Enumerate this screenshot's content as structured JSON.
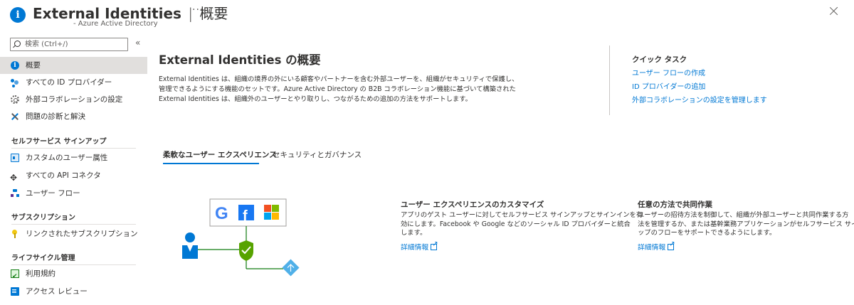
{
  "header": {
    "title": "External Identities",
    "separator": "|",
    "page": "概要",
    "more": "···",
    "subtitle": "- Azure Active Directory",
    "icon": "info-icon",
    "close_icon": "close-icon"
  },
  "sidebar": {
    "search_placeholder": "検索 (Ctrl+/)",
    "collapse": "«",
    "items": [
      {
        "label": "概要",
        "icon": "info-icon"
      },
      {
        "label": "すべての ID プロバイダー",
        "icon": "users-icon"
      },
      {
        "label": "外部コラボレーションの設定",
        "icon": "gear-icon"
      },
      {
        "label": "問題の診断と解決",
        "icon": "wrench-icon"
      }
    ],
    "sections": [
      {
        "title": "セルフサービス サインアップ",
        "items": [
          {
            "label": "カスタムのユーザー属性",
            "icon": "card-icon"
          },
          {
            "label": "すべての API コネクタ",
            "icon": "api-connector-icon"
          },
          {
            "label": "ユーザー フロー",
            "icon": "user-flow-icon"
          }
        ]
      },
      {
        "title": "サブスクリプション",
        "items": [
          {
            "label": "リンクされたサブスクリプション",
            "icon": "key-icon"
          }
        ]
      },
      {
        "title": "ライフサイクル管理",
        "items": [
          {
            "label": "利用規約",
            "icon": "terms-icon"
          },
          {
            "label": "アクセス レビュー",
            "icon": "access-review-icon"
          }
        ]
      }
    ]
  },
  "main": {
    "title": "External Identities の概要",
    "description_lines": [
      "External Identities は、組織の境界の外にいる顧客やパートナーを含む外部ユーザーを、組織がセキュリティで保護し、",
      "管理できるようにする機能のセットです。Azure Active Directory の B2B コラボレーション機能に基づいて構築された",
      "External Identities は、組織外のユーザーとやり取りし、つながるための追加の方法をサポートします。"
    ],
    "quick_tasks": {
      "title": "クイック タスク",
      "links": [
        "ユーザー フローの作成",
        "ID プロバイダーの追加",
        "外部コラボレーションの設定を管理します"
      ]
    },
    "tabs": [
      "柔軟なユーザー エクスペリエンス",
      "セキュリティとガバナンス"
    ],
    "active_tab": 0,
    "cards": [
      {
        "title": "ユーザー エクスペリエンスのカスタマイズ",
        "body_lines": [
          "アプリのゲスト ユーザーに対してセルフサービス サインアップとサインインを有",
          "効にします。Facebook や Google などのソーシャル ID プロバイダーと統合",
          "します。"
        ],
        "link": "詳細情報"
      },
      {
        "title": "任意の方法で共同作業",
        "body_lines": [
          "ユーザーの招待方法を制御して、組織が外部ユーザーと共同作業する方",
          "法を管理するか、または基幹業務アプリケーションがセルフサービス サインア",
          "ップのフローをサポートできるようにします。"
        ],
        "link": "詳細情報"
      }
    ],
    "illustration": {
      "providers": [
        "google-logo-icon",
        "facebook-logo-icon",
        "microsoft-logo-icon"
      ],
      "google_letter": "G",
      "facebook_letter": "f",
      "colors": {
        "google": "#4285f4",
        "facebook": "#1877f2",
        "ms_red": "#f25022",
        "ms_green": "#7fba00",
        "ms_blue": "#00a4ef",
        "ms_yellow": "#ffb900",
        "shield": "#57a300",
        "user": "#0078d4",
        "diamond": "#50b0e8"
      }
    }
  }
}
